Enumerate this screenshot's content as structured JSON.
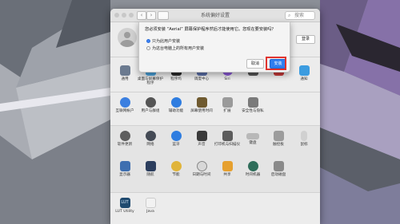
{
  "window": {
    "title": "系统偏好设置",
    "search_placeholder": "搜索",
    "nav_back": "‹",
    "nav_forward": "›"
  },
  "account": {
    "login_button": "登录"
  },
  "sheet": {
    "question": "您必须安装 “Aerial” 屏幕保护程序然后才能使用它。您现在要安装吗？",
    "options": [
      {
        "label": "只为此用户安装",
        "selected": true
      },
      {
        "label": "为这台电脑上的所有用户安装",
        "selected": false
      }
    ],
    "cancel_label": "取消",
    "install_label": "安装"
  },
  "rows": {
    "row1": [
      {
        "label": "通用",
        "color": "#6b7a8f",
        "icon": "general-icon"
      },
      {
        "label": "桌面与屏幕保护程序",
        "color": "#4aa0d8",
        "icon": "desktop-icon"
      },
      {
        "label": "程序坞",
        "color": "#2c2c2c",
        "icon": "dock-icon"
      },
      {
        "label": "调度中心",
        "color": "#5b6fa8",
        "icon": "mission-control-icon"
      },
      {
        "label": "Siri",
        "color": "#8b5ad6",
        "icon": "siri-icon"
      },
      {
        "label": "",
        "color": "#555555",
        "icon": "spotlight-icon"
      },
      {
        "label": "",
        "color": "#c83a3a",
        "icon": "language-icon"
      },
      {
        "label": "通知",
        "color": "#3c9ce0",
        "icon": "notifications-icon"
      }
    ],
    "row2": [
      {
        "label": "互联网帐户",
        "color": "#3b7fe0",
        "icon": "internet-accounts-icon"
      },
      {
        "label": "用户与群组",
        "color": "#555555",
        "icon": "users-groups-icon"
      },
      {
        "label": "辅助功能",
        "color": "#2f7de0",
        "icon": "accessibility-icon"
      },
      {
        "label": "屏幕使用时间",
        "color": "#6f5a2f",
        "icon": "screen-time-icon"
      },
      {
        "label": "扩展",
        "color": "#9a9a9a",
        "icon": "extensions-icon"
      },
      {
        "label": "安全性与隐私",
        "color": "#7a7a7a",
        "icon": "security-icon"
      }
    ],
    "row3": [
      {
        "label": "软件更新",
        "color": "#5e5e5e",
        "icon": "software-update-icon"
      },
      {
        "label": "网络",
        "color": "#444a55",
        "icon": "network-icon"
      },
      {
        "label": "蓝牙",
        "color": "#2f7de0",
        "icon": "bluetooth-icon"
      },
      {
        "label": "声音",
        "color": "#3a3a3a",
        "icon": "sound-icon"
      },
      {
        "label": "打印机与扫描仪",
        "color": "#5c5c5c",
        "icon": "printers-icon"
      },
      {
        "label": "键盘",
        "color": "#b8b8b8",
        "icon": "keyboard-icon"
      },
      {
        "label": "触控板",
        "color": "#9c9c9c",
        "icon": "trackpad-icon"
      },
      {
        "label": "鼠标",
        "color": "#d0d0d0",
        "icon": "mouse-icon"
      }
    ],
    "row4": [
      {
        "label": "显示器",
        "color": "#3f6fb0",
        "icon": "displays-icon"
      },
      {
        "label": "随航",
        "color": "#2c3e5e",
        "icon": "sidecar-icon"
      },
      {
        "label": "节能",
        "color": "#e0b43a",
        "icon": "energy-saver-icon"
      },
      {
        "label": "日期与时间",
        "color": "#d8d8d8",
        "icon": "date-time-icon"
      },
      {
        "label": "共享",
        "color": "#e6a02f",
        "icon": "sharing-icon"
      },
      {
        "label": "时间机器",
        "color": "#2f6d5a",
        "icon": "time-machine-icon"
      },
      {
        "label": "启动磁盘",
        "color": "#8a8a8a",
        "icon": "startup-disk-icon"
      }
    ],
    "row5": [
      {
        "label": "LUT Utility",
        "color": "#1f4a6f",
        "icon": "lut-utility-icon",
        "text": "LUT"
      },
      {
        "label": "Java",
        "color": "#f2f2f2",
        "icon": "java-icon"
      }
    ]
  }
}
